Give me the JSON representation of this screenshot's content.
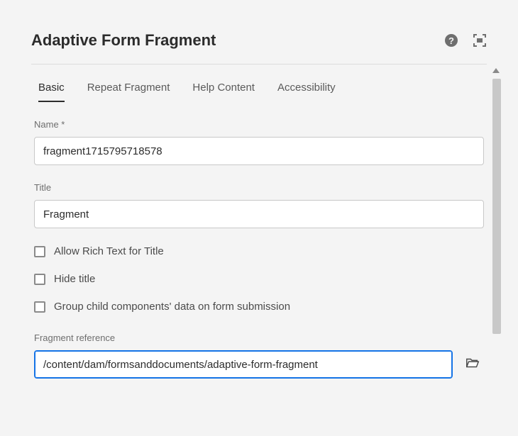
{
  "header": {
    "title": "Adaptive Form Fragment"
  },
  "tabs": [
    "Basic",
    "Repeat Fragment",
    "Help Content",
    "Accessibility"
  ],
  "activeTab": 0,
  "form": {
    "name": {
      "label": "Name *",
      "value": "fragment1715795718578"
    },
    "title": {
      "label": "Title",
      "value": "Fragment"
    },
    "allowRich": {
      "label": "Allow Rich Text for Title",
      "checked": false
    },
    "hideTitle": {
      "label": "Hide title",
      "checked": false
    },
    "groupChild": {
      "label": "Group child components' data on form submission",
      "checked": false
    },
    "fragmentRef": {
      "label": "Fragment reference",
      "value": "/content/dam/formsanddocuments/adaptive-form-fragment"
    }
  }
}
